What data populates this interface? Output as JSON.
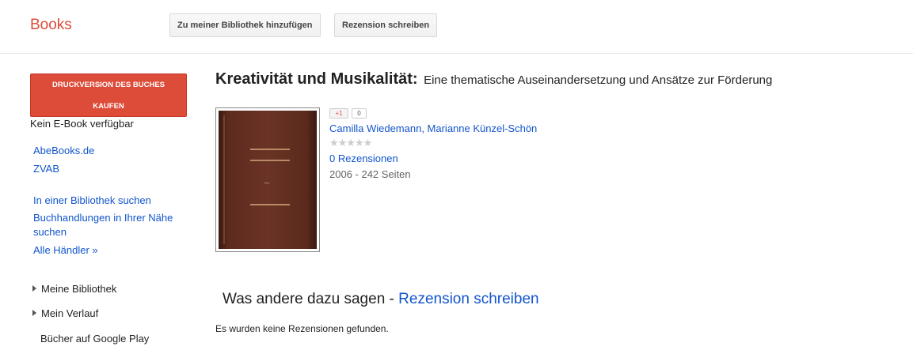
{
  "header": {
    "brand": "Books",
    "add_library_label": "Zu meiner Bibliothek hinzufügen",
    "write_review_label": "Rezension schreiben"
  },
  "sidebar": {
    "buy_line1": "DRUCKVERSION DES BUCHES",
    "buy_line2": "KAUFEN",
    "no_ebook": "Kein E-Book verfügbar",
    "stores": [
      "AbeBooks.de",
      "ZVAB"
    ],
    "library_search": "In einer Bibliothek suchen",
    "nearby_line1": "Buchhandlungen in Ihrer Nähe",
    "nearby_line2": "suchen",
    "all_dealers": "Alle Händler »",
    "my_library": "Meine Bibliothek",
    "my_history": "Mein Verlauf",
    "google_play": "Bücher auf Google Play"
  },
  "book": {
    "title": "Kreativität und Musikalität:",
    "subtitle": "Eine thematische Auseinandersetzung und Ansätze zur Förderung",
    "plus_one": "+1",
    "plus_count": "0",
    "authors": "Camilla Wiedemann, Marianne Künzel-Schön",
    "stars": "★★★★★",
    "reviews": "0 Rezensionen",
    "meta": "2006 - 242 Seiten"
  },
  "reviews_section": {
    "heading": "Was andere dazu sagen",
    "separator": " - ",
    "write_link": "Rezension schreiben",
    "empty": "Es wurden keine Rezensionen gefunden."
  }
}
